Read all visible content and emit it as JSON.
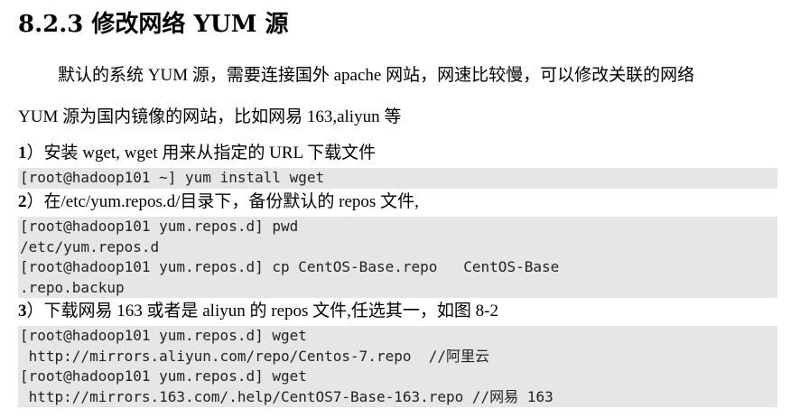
{
  "heading": "8.2.3 修改网络 YUM 源",
  "intro_line1": "默认的系统 YUM 源，需要连接国外 apache 网站，网速比较慢，可以修改关联的网络",
  "intro_line2": "YUM 源为国内镜像的网站，比如网易 163,aliyun 等",
  "steps": [
    {
      "number": "1",
      "text": "）安装 wget, wget 用来从指定的 URL 下载文件",
      "code": [
        "[root@hadoop101 ~] yum install wget"
      ]
    },
    {
      "number": "2",
      "text": "）在/etc/yum.repos.d/目录下，备份默认的 repos 文件,",
      "code": [
        "[root@hadoop101 yum.repos.d] pwd",
        "/etc/yum.repos.d",
        "[root@hadoop101 yum.repos.d] cp CentOS-Base.repo   CentOS-Base",
        ".repo.backup"
      ]
    },
    {
      "number": "3",
      "text": "）下载网易 163 或者是 aliyun 的 repos 文件,任选其一，如图 8-2",
      "code": [
        "[root@hadoop101 yum.repos.d] wget",
        " http://mirrors.aliyun.com/repo/Centos-7.repo  //阿里云",
        "[root@hadoop101 yum.repos.d] wget",
        " http://mirrors.163.com/.help/CentOS7-Base-163.repo //网易 163"
      ]
    }
  ]
}
